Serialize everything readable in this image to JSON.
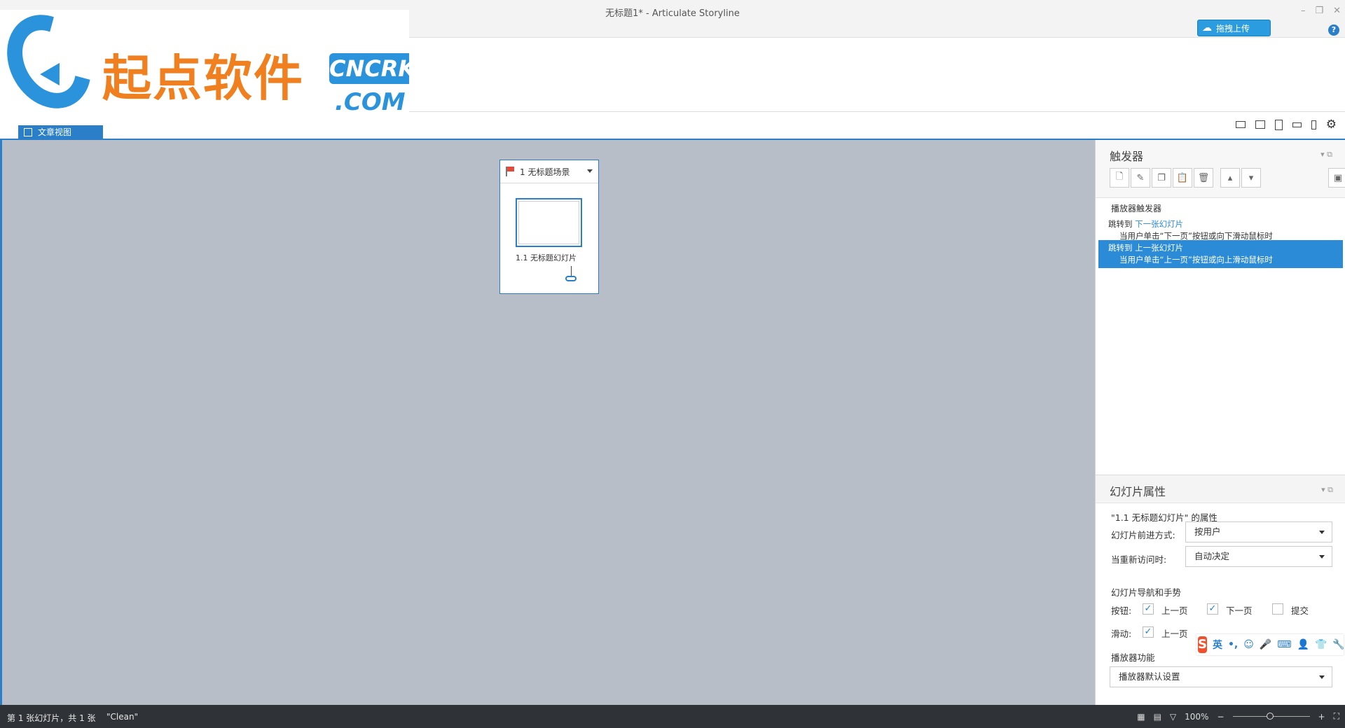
{
  "window": {
    "title": "无标题1* -  Articulate Storyline",
    "upload_label": "拖拽上传",
    "help": "?",
    "min": "–",
    "restore": "❐",
    "close": "✕"
  },
  "logo": {
    "cn_text": "起点软件",
    "badge": "CNCRK",
    "dotcom": ".COM"
  },
  "tabs": {
    "story_view": "文章视图"
  },
  "scene": {
    "title": "1 无标题场景",
    "slide_label": "1.1 无标题幻灯片"
  },
  "triggers": {
    "title": "触发器",
    "group": "播放器触发器",
    "items": [
      {
        "action": "跳转到",
        "target": "下一张幻灯片",
        "condition": "当用户单击“下一页”按钮或向下滑动鼠标时",
        "selected": false
      },
      {
        "action": "跳转到",
        "target": "上一张幻灯片",
        "condition": "当用户单击“上一页”按钮或向上滑动鼠标时",
        "selected": true
      }
    ]
  },
  "props": {
    "title": "幻灯片属性",
    "subtitle": "\"1.1 无标题幻灯片\" 的属性",
    "advance_label": "幻灯片前进方式:",
    "advance_value": "按用户",
    "revisit_label": "当重新访问时:",
    "revisit_value": "自动决定",
    "nav_title": "幻灯片导航和手势",
    "buttons_label": "按钮:",
    "prev": "上一页",
    "next": "下一页",
    "submit": "提交",
    "swipe_label": "滑动:",
    "swipe_prev": "上一页",
    "player_title": "播放器功能",
    "player_value": "播放器默认设置"
  },
  "ime": {
    "lang": "英"
  },
  "status": {
    "slide_info": "第 1 张幻灯片，共 1 张",
    "theme": "\"Clean\"",
    "zoom": "100%"
  }
}
